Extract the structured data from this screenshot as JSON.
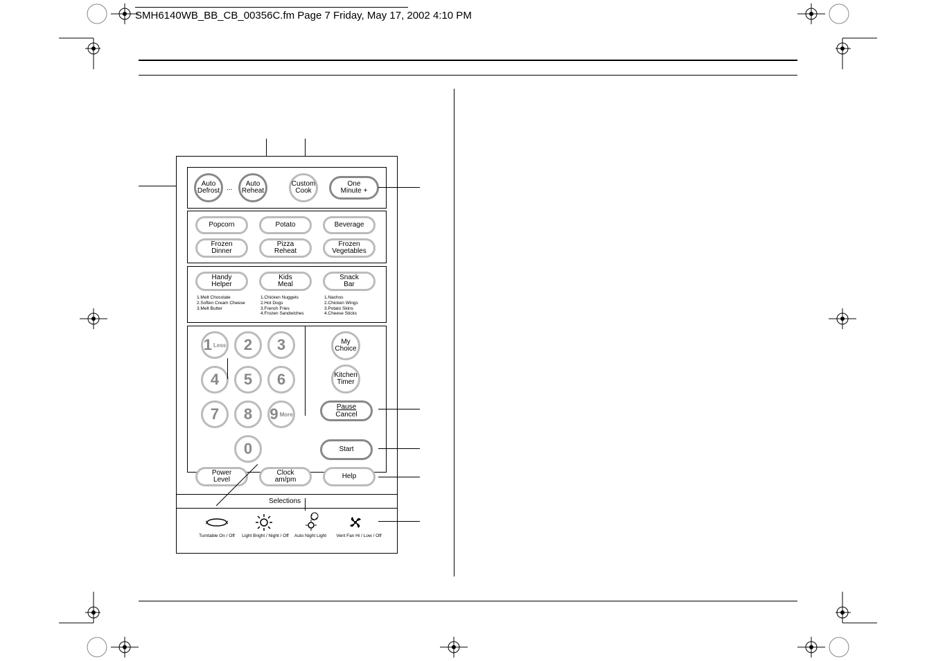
{
  "filename": "SMH6140WB_BB_CB_00356C.fm  Page 7  Friday, May 17, 2002  4:10 PM",
  "row1": {
    "b1l1": "Auto",
    "b1l2": "Defrost",
    "dots": "...",
    "b2l1": "Auto",
    "b2l2": "Reheat",
    "b3l1": "Custom",
    "b3l2": "Cook",
    "b4l1": "One",
    "b4l2": "Minute +"
  },
  "row2": {
    "b1": "Popcorn",
    "b2": "Potato",
    "b3": "Beverage",
    "b4l1": "Frozen",
    "b4l2": "Dinner",
    "b5l1": "Pizza",
    "b5l2": "Reheat",
    "b6l1": "Frozen",
    "b6l2": "Vegetables"
  },
  "row3": {
    "b1l1": "Handy",
    "b1l2": "Helper",
    "b2l1": "Kids",
    "b2l2": "Meal",
    "b3l1": "Snack",
    "b3l2": "Bar"
  },
  "lists": {
    "handy": "1.Melt Chocolate\n2.Soften Cream Cheese\n3.Melt Butter",
    "kids": "1.Chicken Nuggets\n2.Hot Dogs\n3.French Fries\n4.Frozen Sandwiches",
    "snack": "1.Nachos\n2.Chicken Wings\n3.Potato Skins\n4.Cheese Sticks"
  },
  "keypad": {
    "k1": "1",
    "k1s": "Less",
    "k2": "2",
    "k3": "3",
    "k4": "4",
    "k5": "5",
    "k6": "6",
    "k7": "7",
    "k8": "8",
    "k9": "9",
    "k9s": "More",
    "k0": "0"
  },
  "right": {
    "b1l1": "My",
    "b1l2": "Choice",
    "b2l1": "Kitchen",
    "b2l2": "Timer",
    "b3l1": "Pause",
    "b3l2": "Cancel",
    "b4": "Start",
    "b5": "Help"
  },
  "bottom": {
    "b1l1": "Power",
    "b1l2": "Level",
    "b2l1": "Clock",
    "b2l2": "am/pm"
  },
  "selections": "Selections",
  "icons": {
    "i1": "Turntable On / Off",
    "i2": "Light Bright / Night / Off",
    "i3": "Auto Night Light",
    "i4": "Vent Fan Hi / Low / Off"
  }
}
